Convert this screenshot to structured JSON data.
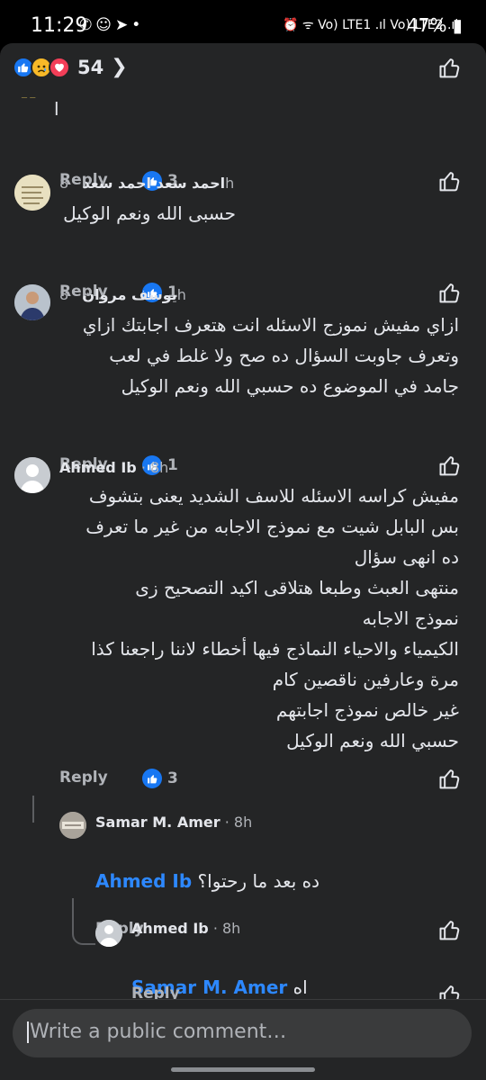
{
  "status_bar": {
    "time": "11:29",
    "left_icons": [
      "whatsapp-icon",
      "snapchat-icon",
      "telegram-icon",
      "dot-icon"
    ],
    "right_icons_text": "⏰ ᯤ Vo) LTE1 .ıl Vo) LTE2 .ıl",
    "battery": "47%"
  },
  "reactions": {
    "icons": [
      "like-icon",
      "sad-icon",
      "love-icon"
    ],
    "count": "54"
  },
  "comments": [
    {
      "body": "ا",
      "reply_label": "Reply",
      "likes": "3"
    },
    {
      "author": "احمد سعد احمد سعد",
      "time": "8h",
      "body": "حسبى الله ونعم الوكيل",
      "reply_label": "Reply",
      "likes": "1"
    },
    {
      "author": "يوسف مروان",
      "time": "8h",
      "body": "ازاي مفيش نموزج الاسئله انت هتعرف اجابتك ازاي\nوتعرف جاوبت السؤال ده صح ولا غلط في لعب\nجامد في الموضوع ده حسبي الله ونعم الوكيل",
      "reply_label": "Reply",
      "likes": "1"
    },
    {
      "author": "Ahmed Ib",
      "time": "8h",
      "body": "مفيش كراسه الاسئله للاسف الشديد يعنى بتشوف\nبس البابل شيت مع نموذج الاجابه من غير ما تعرف\nده انهى سؤال\nمنتهى العبث وطبعا هتلاقى اكيد التصحيح زى\nنموذج الاجابه\nالكيمياء والاحياء النماذج فيها أخطاء لاننا راجعنا كذا\nمرة وعارفين ناقصين كام\nغير خالص نموذج اجابتهم\nحسبي الله ونعم الوكيل",
      "reply_label": "Reply",
      "likes": "3"
    },
    {
      "author": "Samar M. Amer",
      "time": "8h",
      "mention": "Ahmed Ib",
      "body": "ده بعد ما رحتوا؟",
      "reply_label": "Reply"
    },
    {
      "author": "Ahmed Ib",
      "time": "8h",
      "mention": "Samar M. Amer",
      "body": "اه",
      "reply_label": "Reply"
    }
  ],
  "composer": {
    "placeholder": "Write a public comment…"
  },
  "colors": {
    "background": "#242526",
    "accent": "#1877f2",
    "mention": "#2d88ff"
  }
}
